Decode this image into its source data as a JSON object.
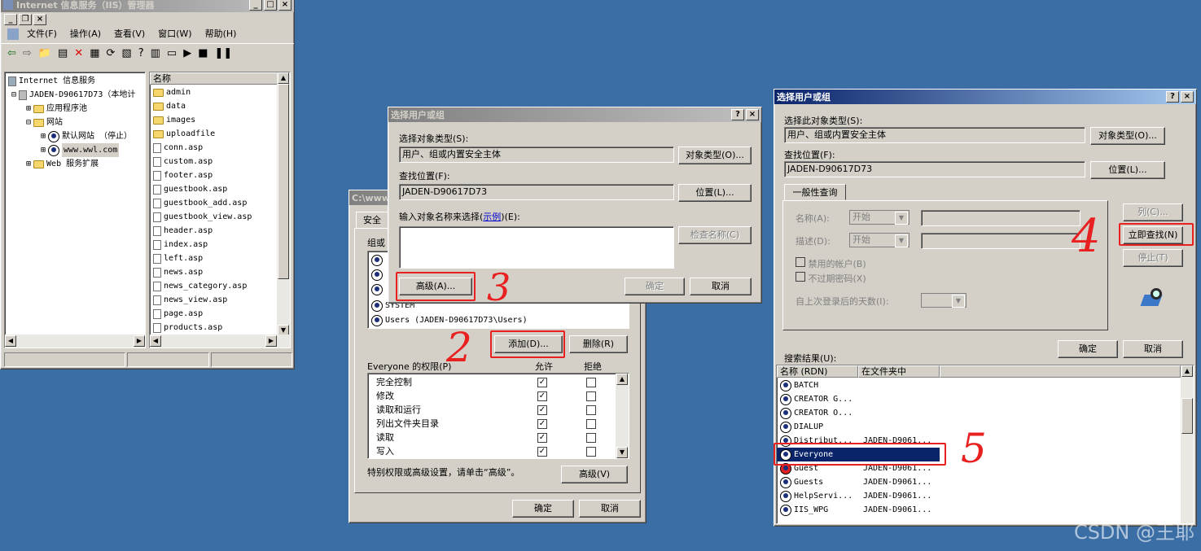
{
  "iis": {
    "title": "Internet 信息服务（IIS）管理器",
    "menu": [
      "文件(F)",
      "操作(A)",
      "查看(V)",
      "窗口(W)",
      "帮助(H)"
    ],
    "tree": [
      {
        "label": "Internet 信息服务",
        "level": 0
      },
      {
        "label": "JADEN-D90617D73（本地计",
        "level": 1
      },
      {
        "label": "应用程序池",
        "level": 2
      },
      {
        "label": "网站",
        "level": 2
      },
      {
        "label": "默认网站 （停止）",
        "level": 3
      },
      {
        "label": "www.wwl.com",
        "level": 3
      },
      {
        "label": "Web 服务扩展",
        "level": 2
      }
    ],
    "list_header": "名称",
    "files": [
      {
        "name": "admin",
        "type": "folder"
      },
      {
        "name": "data",
        "type": "folder"
      },
      {
        "name": "images",
        "type": "folder"
      },
      {
        "name": "uploadfile",
        "type": "folder"
      },
      {
        "name": "conn.asp",
        "type": "file"
      },
      {
        "name": "custom.asp",
        "type": "file"
      },
      {
        "name": "footer.asp",
        "type": "file"
      },
      {
        "name": "guestbook.asp",
        "type": "file"
      },
      {
        "name": "guestbook_add.asp",
        "type": "file"
      },
      {
        "name": "guestbook_view.asp",
        "type": "file"
      },
      {
        "name": "header.asp",
        "type": "file"
      },
      {
        "name": "index.asp",
        "type": "file"
      },
      {
        "name": "left.asp",
        "type": "file"
      },
      {
        "name": "news.asp",
        "type": "file"
      },
      {
        "name": "news_category.asp",
        "type": "file"
      },
      {
        "name": "news_view.asp",
        "type": "file"
      },
      {
        "name": "page.asp",
        "type": "file"
      },
      {
        "name": "products.asp",
        "type": "file"
      }
    ]
  },
  "props": {
    "title": "C:\\www",
    "tab": "安全",
    "group_label": "组或",
    "users": [
      "SYSTEM",
      "Users (JADEN-D90617D73\\Users)"
    ],
    "add_btn": "添加(D)...",
    "remove_btn": "删除(R)",
    "perm_label": "Everyone 的权限(P)",
    "allow": "允许",
    "deny": "拒绝",
    "perms": [
      {
        "name": "完全控制",
        "allow": true,
        "deny": false
      },
      {
        "name": "修改",
        "allow": true,
        "deny": false
      },
      {
        "name": "读取和运行",
        "allow": true,
        "deny": false
      },
      {
        "name": "列出文件夹目录",
        "allow": true,
        "deny": false
      },
      {
        "name": "读取",
        "allow": true,
        "deny": false
      },
      {
        "name": "写入",
        "allow": true,
        "deny": false
      }
    ],
    "special_text": "特别权限或高级设置，请单击“高级”。",
    "advanced_btn": "高级(V)",
    "ok": "确定",
    "cancel": "取消"
  },
  "select1": {
    "title": "选择用户或组",
    "type_label": "选择对象类型(S):",
    "type_value": "用户、组或内置安全主体",
    "type_btn": "对象类型(O)...",
    "loc_label": "查找位置(F):",
    "loc_value": "JADEN-D90617D73",
    "loc_btn": "位置(L)...",
    "name_label_a": "输入对象名称来选择(",
    "name_label_link": "示例",
    "name_label_b": ")(E):",
    "check_btn": "检查名称(C)",
    "advanced_btn": "高级(A)...",
    "ok": "确定",
    "cancel": "取消"
  },
  "select2": {
    "title": "选择用户或组",
    "type_label": "选择此对象类型(S):",
    "type_value": "用户、组或内置安全主体",
    "type_btn": "对象类型(O)...",
    "loc_label": "查找位置(F):",
    "loc_value": "JADEN-D90617D73",
    "loc_btn": "位置(L)...",
    "tab": "一般性查询",
    "name_label": "名称(A):",
    "desc_label": "描述(D):",
    "start": "开始",
    "disabled_acct": "禁用的帐户(B)",
    "no_expire": "不过期密码(X)",
    "days_label": "自上次登录后的天数(I):",
    "col_btn": "列(C)...",
    "find_btn": "立即查找(N)",
    "stop_btn": "停止(T)",
    "ok": "确定",
    "cancel": "取消",
    "results_label": "搜索结果(U):",
    "col_name": "名称 (RDN)",
    "col_folder": "在文件夹中",
    "results": [
      {
        "name": "BATCH",
        "folder": ""
      },
      {
        "name": "CREATOR G...",
        "folder": ""
      },
      {
        "name": "CREATOR O...",
        "folder": ""
      },
      {
        "name": "DIALUP",
        "folder": ""
      },
      {
        "name": "Distribut...",
        "folder": "JADEN-D9061..."
      },
      {
        "name": "Everyone",
        "folder": ""
      },
      {
        "name": "Guest",
        "folder": "JADEN-D9061..."
      },
      {
        "name": "Guests",
        "folder": "JADEN-D9061..."
      },
      {
        "name": "HelpServi...",
        "folder": "JADEN-D9061..."
      },
      {
        "name": "IIS_WPG",
        "folder": "JADEN-D9061..."
      }
    ]
  },
  "annotations": [
    "2",
    "3",
    "4",
    "5"
  ],
  "watermark": "CSDN @王耶",
  "colors": {
    "desktop": "#3a6ea5",
    "annotation": "#e82020",
    "selection": "#0a246a"
  }
}
